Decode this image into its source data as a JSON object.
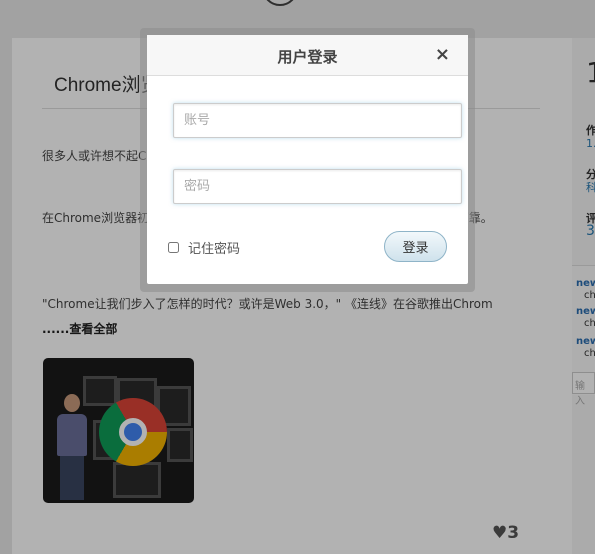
{
  "article": {
    "title": "Chrome浏览",
    "para1": "很多人或许想不起C                                                              ，它如此热门的背后原因之一是，",
    "para2": "在Chrome浏览器初                                                              等知名竞争对手。但他们确实将                                                       浏览体验明显更安全、更可靠。",
    "quote": "\"Chrome让我们步入了怎样的时代？或许是Web 3.0，\" 《连线》在谷歌推出Chrom",
    "read_more": "......查看全部",
    "likes_count": "3"
  },
  "sidebar": {
    "big_char": "1",
    "items": [
      {
        "heading": "作",
        "link": "1."
      },
      {
        "heading": "分",
        "link": "科"
      },
      {
        "heading": "评",
        "link": "3"
      }
    ],
    "comments": [
      {
        "user": "new",
        "text": "ch"
      },
      {
        "user": "new",
        "text": "ch"
      },
      {
        "user": "new",
        "text": "ch"
      }
    ],
    "input_placeholder": "输入"
  },
  "login_modal": {
    "title": "用户登录",
    "close_glyph": "×",
    "account_placeholder": "账号",
    "password_placeholder": "密码",
    "remember_label": "记住密码",
    "login_label": "登录"
  },
  "colors": {
    "overlay": "rgba(0,0,0,0.30)",
    "link": "#2a7ab0",
    "button_border": "#8fb4c8"
  }
}
